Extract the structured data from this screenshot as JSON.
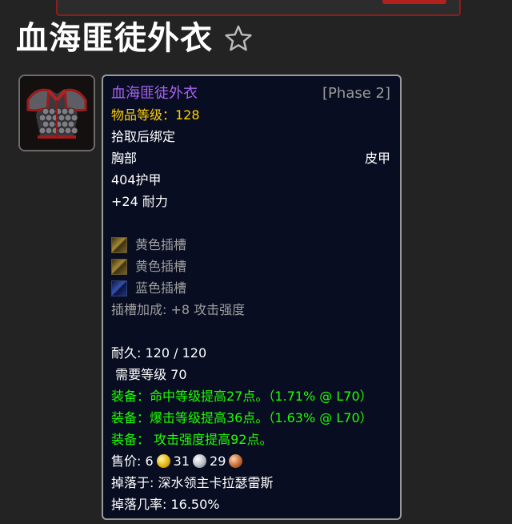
{
  "page": {
    "title": "血海匪徒外衣"
  },
  "icons": {
    "favorite": "star-outline-icon",
    "item": "chest-armor-icon"
  },
  "colors": {
    "epic": "#a463ee",
    "item_level": "#ffd100",
    "equip_green": "#1eff00",
    "socket_bonus_gray": "#9d9d9d",
    "tooltip_bg": "#090d21"
  },
  "tooltip": {
    "name": "血海匪徒外衣",
    "phase": "[Phase 2]",
    "item_level": "物品等级：128",
    "binding": "拾取后绑定",
    "slot": "胸部",
    "armor_type": "皮甲",
    "armor": "404护甲",
    "stamina": "+24 耐力",
    "sockets": [
      {
        "color": "yellow",
        "label": "黄色插槽"
      },
      {
        "color": "yellow",
        "label": "黄色插槽"
      },
      {
        "color": "blue",
        "label": "蓝色插槽"
      }
    ],
    "socket_bonus": "插槽加成: +8 攻击强度",
    "durability": "耐久: 120 / 120",
    "required_level": " 需要等级 70",
    "equip_effects": [
      "装备：命中等级提高27点。（1.71% @ L70）",
      "装备：爆击等级提高36点。（1.63% @ L70）",
      "装备： 攻击强度提高92点。"
    ],
    "sell_price": {
      "label": "售价: ",
      "gold": "6",
      "silver": "31",
      "copper": "29"
    },
    "dropped_by": "掉落于: 深水领主卡拉瑟雷斯",
    "drop_rate": "掉落几率: 16.50%"
  }
}
